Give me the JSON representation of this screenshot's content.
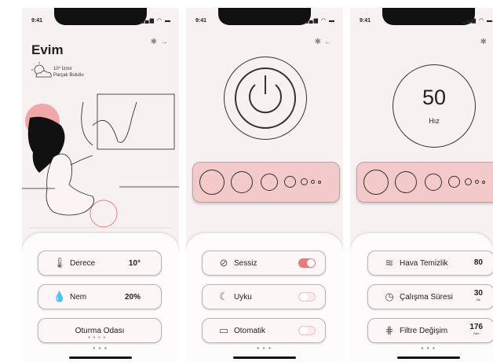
{
  "status": {
    "time": "9:41",
    "icons": "▂▄▆ ◠ ▬"
  },
  "screen1": {
    "title": "Evim",
    "weather_temp": "10° İzmir",
    "weather_desc": "Parçalı Bulutlu",
    "cards": [
      {
        "label": "Derece",
        "value": "10°",
        "icon": "thermometer-icon"
      },
      {
        "label": "Nem",
        "value": "20%",
        "icon": "droplet-icon"
      },
      {
        "label": "Oturma Odası"
      }
    ],
    "card_dots": "● ● ● ●",
    "page_dots": "● ● ●"
  },
  "screen2": {
    "rows": [
      {
        "label": "Sessiz",
        "toggle": "on",
        "icon": "mute-icon"
      },
      {
        "label": "Uyku",
        "toggle": "off",
        "icon": "moon-icon"
      },
      {
        "label": "Otomatik",
        "toggle": "off",
        "icon": "auto-icon"
      }
    ],
    "page_dots": "● ● ●"
  },
  "screen3": {
    "speed_value": "50",
    "speed_label": "Hız",
    "rows": [
      {
        "label": "Hava Temizlik",
        "value": "80",
        "unit": "",
        "icon": "wind-icon"
      },
      {
        "label": "Çalışma Süresi",
        "value": "30",
        "unit": "Dk",
        "icon": "clock-icon"
      },
      {
        "label": "Filtre Değişim",
        "value": "176",
        "unit": "Gün",
        "icon": "filter-icon"
      }
    ],
    "page_dots": "● ● ●"
  },
  "colors": {
    "accent": "#e97b7b",
    "panel_pink": "#f3c9c9",
    "background": "#f7f1f1"
  }
}
